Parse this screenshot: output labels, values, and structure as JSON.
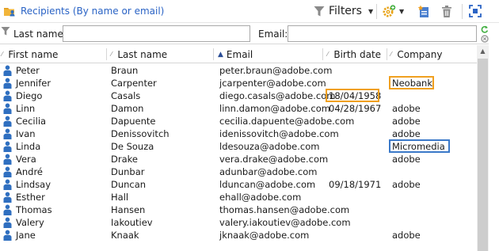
{
  "toolbar": {
    "title": "Recipients (By name or email)",
    "filters_label": "Filters",
    "icons": [
      "folder-person-icon",
      "funnel-icon",
      "gear-add-icon",
      "new-record-icon",
      "trash-icon",
      "fullscreen-icon"
    ]
  },
  "search": {
    "last_name_label": "Last name:",
    "last_name_value": "",
    "email_label": "Email:",
    "email_value": ""
  },
  "columns": [
    "First name",
    "Last name",
    "Email",
    "Birth date",
    "Company"
  ],
  "sort": {
    "column": "Email",
    "direction": "ascending"
  },
  "rows": [
    {
      "first": "Peter",
      "last": "Braun",
      "email": "peter.braun@adobe.com",
      "birth": "",
      "company": ""
    },
    {
      "first": "Jennifer",
      "last": "Carpenter",
      "email": "jcarpenter@adobe.com",
      "birth": "",
      "company": "Neobank"
    },
    {
      "first": "Diego",
      "last": "Casals",
      "email": "diego.casals@adobe.com",
      "birth": "18/04/1958",
      "company": ""
    },
    {
      "first": "Linn",
      "last": "Damon",
      "email": "linn.damon@adobe.com",
      "birth": "04/28/1967",
      "company": "adobe"
    },
    {
      "first": "Cecilia",
      "last": "Dapuente",
      "email": "cecilia.dapuente@adobe.com",
      "birth": "",
      "company": "adobe"
    },
    {
      "first": "Ivan",
      "last": "Denissovitch",
      "email": "idenissovitch@adobe.com",
      "birth": "",
      "company": "adobe"
    },
    {
      "first": "Linda",
      "last": "De Souza",
      "email": "ldesouza@adobe.com",
      "birth": "",
      "company": "Micromedia"
    },
    {
      "first": "Vera",
      "last": "Drake",
      "email": "vera.drake@adobe.com",
      "birth": "",
      "company": "adobe"
    },
    {
      "first": "André",
      "last": "Dunbar",
      "email": "adunbar@adobe.com",
      "birth": "",
      "company": ""
    },
    {
      "first": "Lindsay",
      "last": "Duncan",
      "email": "lduncan@adobe.com",
      "birth": "09/18/1971",
      "company": "adobe"
    },
    {
      "first": "Esther",
      "last": "Hall",
      "email": "ehall@adobe.com",
      "birth": "",
      "company": ""
    },
    {
      "first": "Thomas",
      "last": "Hansen",
      "email": "thomas.hansen@adobe.com",
      "birth": "",
      "company": ""
    },
    {
      "first": "Valery",
      "last": "Iakoutiev",
      "email": "valery.iakoutiev@adobe.com",
      "birth": "",
      "company": ""
    },
    {
      "first": "Jane",
      "last": "Knaak",
      "email": "jknaak@adobe.com",
      "birth": "",
      "company": "adobe"
    }
  ],
  "highlights": {
    "orange_color": "#f0a020",
    "blue_color": "#3b79c9",
    "orange_cells": [
      "Neobank",
      "18/04/1958"
    ],
    "blue_cells": [
      "Micromedia"
    ]
  },
  "colors": {
    "accent": "#2a63c5",
    "person_icon": "#2f6fc0"
  }
}
